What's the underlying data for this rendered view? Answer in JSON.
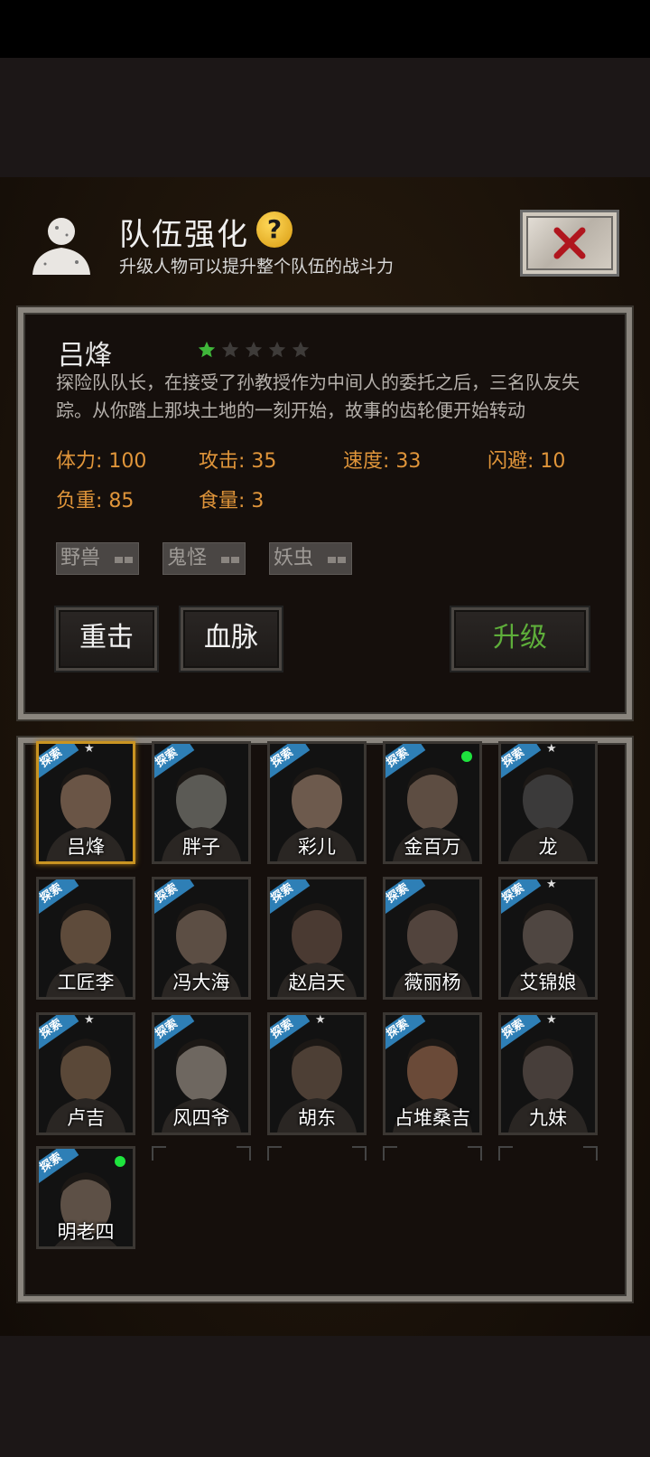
{
  "header": {
    "title": "队伍强化",
    "help_icon": "question-icon",
    "subtitle": "升级人物可以提升整个队伍的战斗力",
    "close_icon": "close-x-icon"
  },
  "character": {
    "name": "吕烽",
    "stars_filled": 1,
    "stars_total": 5,
    "description": "探险队队长，在接受了孙教授作为中间人的委托之后，三名队友失踪。从你踏上那块土地的一刻开始，故事的齿轮便开始转动",
    "stats": {
      "stamina": "体力: 100",
      "attack": "攻击: 35",
      "speed": "速度: 33",
      "dodge": "闪避: 10",
      "load": "负重: 85",
      "food": "食量: 3"
    },
    "tags": [
      "野兽",
      "鬼怪",
      "妖虫"
    ],
    "skill1": "重击",
    "skill2": "血脉",
    "upgrade": "升级"
  },
  "roster": [
    {
      "name": "吕烽",
      "badge": "探索",
      "star": true,
      "dot": false,
      "selected": true
    },
    {
      "name": "胖子",
      "badge": "探索",
      "star": false,
      "dot": false
    },
    {
      "name": "彩儿",
      "badge": "探索",
      "star": false,
      "dot": false
    },
    {
      "name": "金百万",
      "badge": "探索",
      "star": false,
      "dot": true
    },
    {
      "name": "龙",
      "badge": "探索",
      "star": true,
      "dot": false
    },
    {
      "name": "工匠李",
      "badge": "探索",
      "star": false,
      "dot": false
    },
    {
      "name": "冯大海",
      "badge": "探索",
      "star": false,
      "dot": false
    },
    {
      "name": "赵启天",
      "badge": "探索",
      "star": false,
      "dot": false
    },
    {
      "name": "薇丽杨",
      "badge": "探索",
      "star": false,
      "dot": false
    },
    {
      "name": "艾锦娘",
      "badge": "探索",
      "star": true,
      "dot": false
    },
    {
      "name": "卢吉",
      "badge": "探索",
      "star": true,
      "dot": false
    },
    {
      "name": "风四爷",
      "badge": "探索",
      "star": false,
      "dot": false
    },
    {
      "name": "胡东",
      "badge": "探索",
      "star": true,
      "dot": false
    },
    {
      "name": "占堆桑吉",
      "badge": "探索",
      "star": false,
      "dot": false
    },
    {
      "name": "九妹",
      "badge": "探索",
      "star": true,
      "dot": false
    },
    {
      "name": "明老四",
      "badge": "探索",
      "star": false,
      "dot": true
    }
  ],
  "colors": {
    "stat": "#e0953a",
    "upgrade": "#5eae3a",
    "badge": "#2e7fb6",
    "selected_border": "#c99422",
    "online_dot": "#1ee43e"
  }
}
